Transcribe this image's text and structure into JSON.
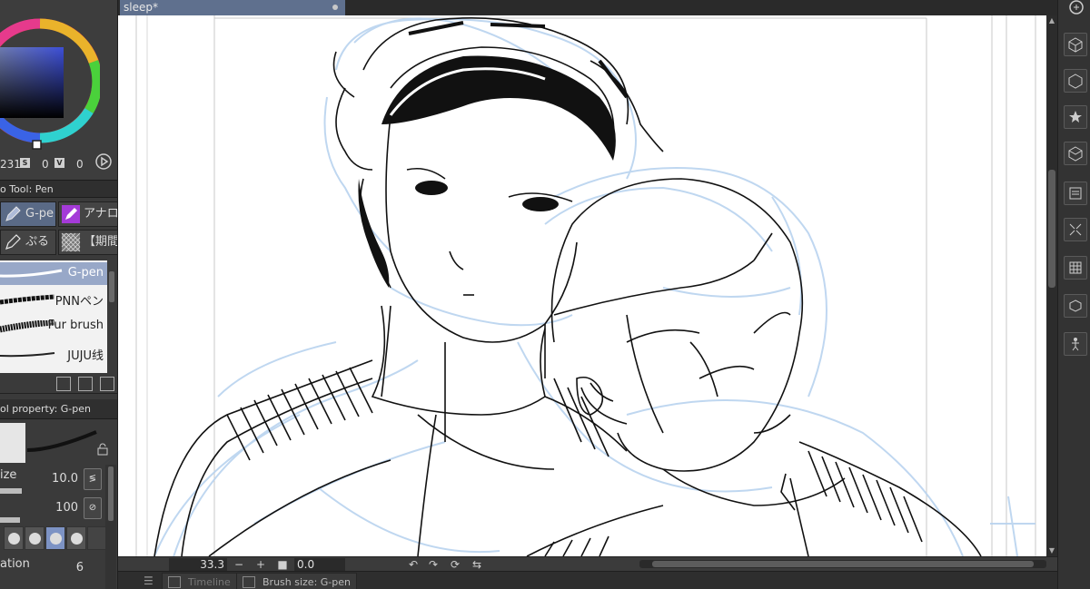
{
  "document": {
    "tab_title": "sleep*"
  },
  "color": {
    "hue_value": "231",
    "s_label": "S",
    "s_value": "0",
    "v_label": "V",
    "v_value": "0",
    "main_color": "#3d4fd8"
  },
  "subtool": {
    "header": "o Tool: Pen",
    "tabs": [
      {
        "label": "G-pe",
        "active": true
      },
      {
        "label": "アナロ",
        "active": false
      },
      {
        "label": "ぷる",
        "active": false
      },
      {
        "label": "【期間",
        "active": false
      }
    ],
    "brushes": [
      {
        "label": "G-pen",
        "selected": true
      },
      {
        "label": "PNNペン",
        "selected": false
      },
      {
        "label": "Fur brush",
        "selected": false
      },
      {
        "label": "JUJU线",
        "selected": false
      }
    ]
  },
  "tool_property": {
    "header": "ol property: G-pen",
    "size_label": "ize",
    "size_value": "10.0",
    "opacity_value": "100",
    "stabilization_label": "ation",
    "stabilization_value": "6"
  },
  "navigator": {
    "zoom": "33.3",
    "rotation": "0.0",
    "minus": "−",
    "plus": "+"
  },
  "status_tabs": [
    {
      "label": "Timeline",
      "dim": true
    },
    {
      "label": "Brush size: G-pen",
      "dim": false
    }
  ],
  "right_icons": [
    "cube-icon",
    "cube-outline-icon",
    "star-icon",
    "material-icon",
    "layer-property-icon",
    "transform-icon",
    "grid-icon",
    "cube-small-icon",
    "figure-icon"
  ]
}
